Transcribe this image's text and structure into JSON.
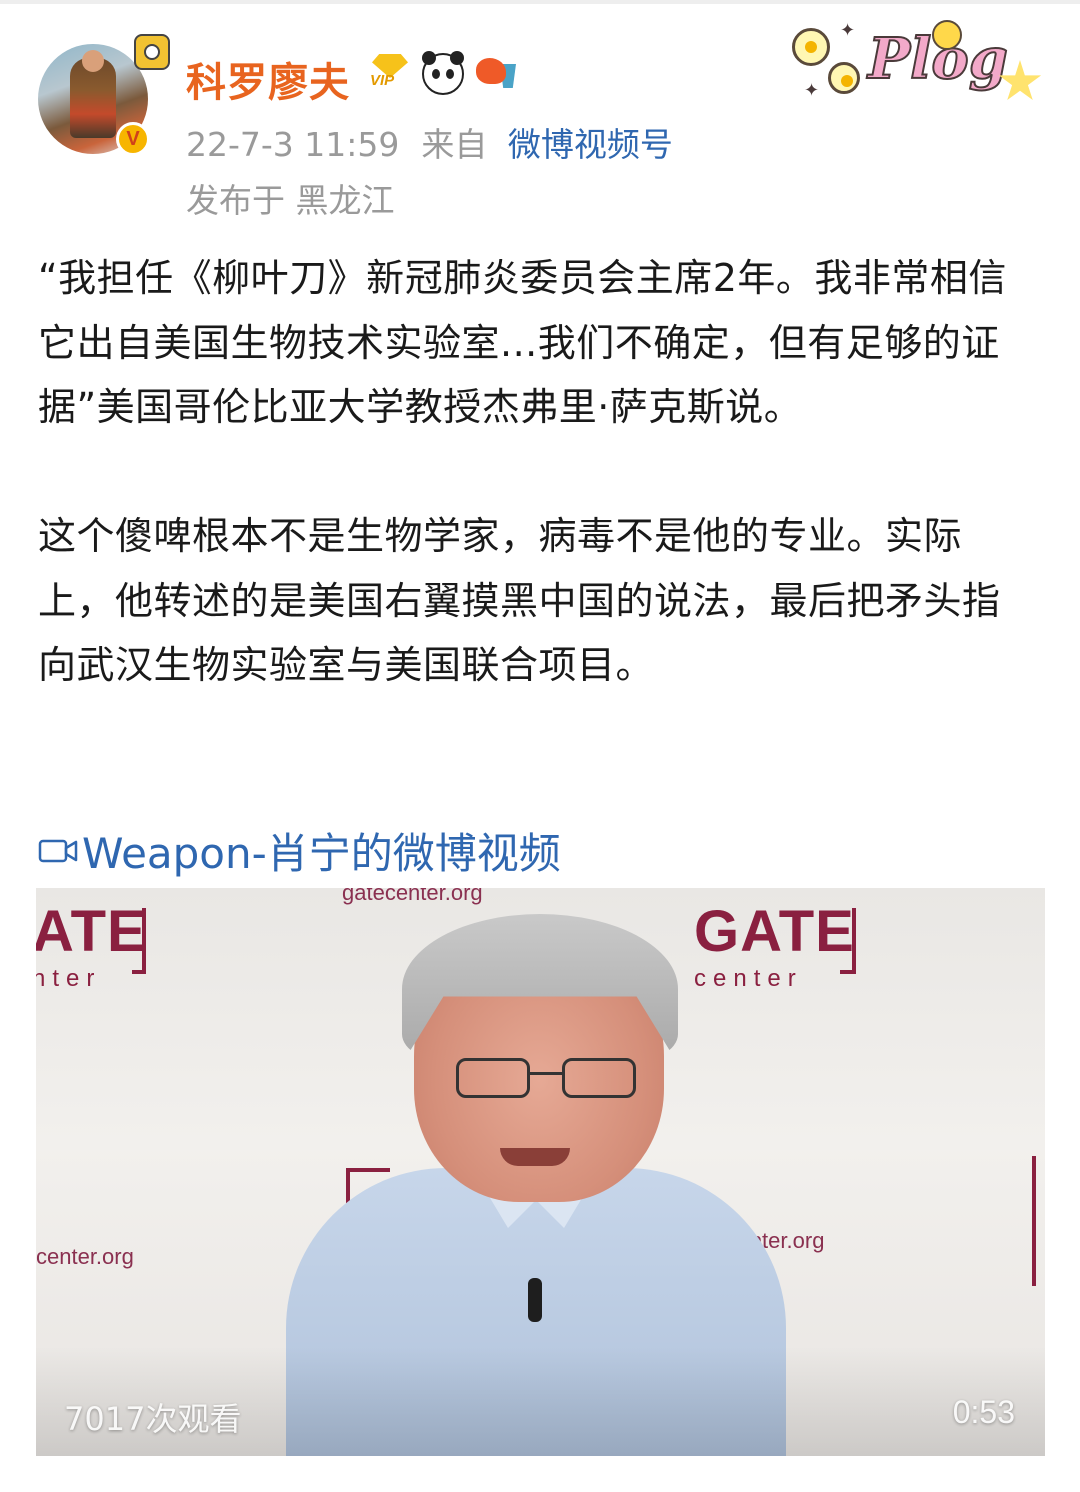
{
  "post": {
    "author": "科罗廖夫",
    "time": "22-7-3 11:59",
    "from_label": "来自",
    "source": "微博视频号",
    "location": "发布于 黑龙江",
    "sticker_text": "Plog",
    "vip_badge_text": "VIP",
    "avatar_badge": "V",
    "paragraphs": [
      "“我担任《柳叶刀》新冠肺炎委员会主席2年。我非常相信它出自美国生物技术实验室...我们不确定，但有足够的证据”美国哥伦比亚大学教授杰弗里·萨克斯说。",
      "这个傻啤根本不是生物学家，病毒不是他的专业。实际上，他转述的是美国右翼摸黑中国的说法，最后把矛头指向武汉生物实验室与美国联合项目。"
    ]
  },
  "video": {
    "link_label": "Weapon-肖宁的微博视频",
    "view_count": "7017次观看",
    "duration": "0:53",
    "background_text": {
      "logo_left": "ATE",
      "logo_left_sub": "nter",
      "logo_right": "GATE",
      "logo_right_sub": "center",
      "url_top": "gatecenter.org",
      "url_left": "center.org",
      "url_right": "atecenter.org"
    }
  },
  "colors": {
    "author": "#e8641f",
    "link": "#2f67b0",
    "meta": "#9a9a9a",
    "brand_maroon": "#8a2040"
  },
  "icons": [
    "video-camera-icon",
    "vip-diamond-icon",
    "panda-icon",
    "fish-icon",
    "verified-v-icon"
  ]
}
